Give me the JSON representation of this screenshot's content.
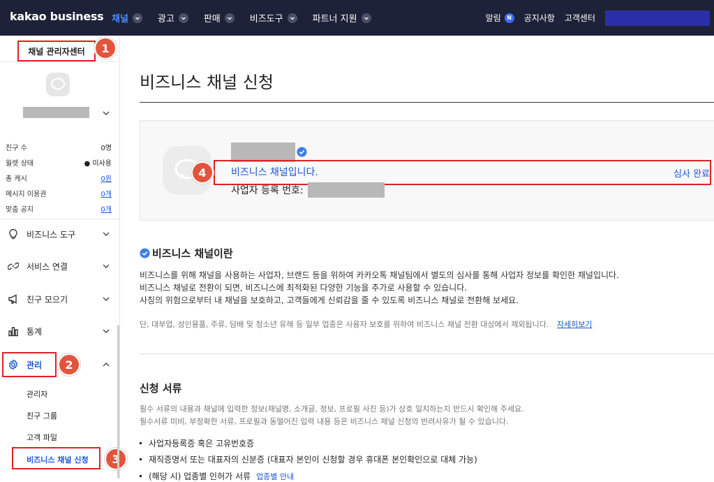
{
  "header": {
    "logo": "kakao business",
    "nav": [
      {
        "label": "채널",
        "active": true
      },
      {
        "label": "광고",
        "active": false
      },
      {
        "label": "판매",
        "active": false
      },
      {
        "label": "비즈도구",
        "active": false
      },
      {
        "label": "파트너 지원",
        "active": false
      }
    ],
    "alerts_label": "알림",
    "alerts_badge": "N",
    "notice_label": "공지사항",
    "support_label": "고객센터"
  },
  "sidebar": {
    "title": "채널 관리자센터",
    "stats": [
      {
        "label": "친구 수",
        "value": "0명"
      },
      {
        "label": "월렛 상태",
        "value": "미사용"
      },
      {
        "label": "총 캐시",
        "value": "0원"
      },
      {
        "label": "메시지 이용권",
        "value": "0개"
      },
      {
        "label": "맞춤 공지",
        "value": "0개"
      }
    ],
    "menu": [
      {
        "label": "비즈니스 도구"
      },
      {
        "label": "서비스 연결"
      },
      {
        "label": "친구 모으기"
      },
      {
        "label": "통계"
      },
      {
        "label": "관리"
      }
    ],
    "submenu": [
      {
        "label": "관리자"
      },
      {
        "label": "친구 그룹"
      },
      {
        "label": "고객 파일"
      },
      {
        "label": "비즈니스 채널 신청"
      }
    ]
  },
  "callouts": [
    "1",
    "2",
    "3",
    "4"
  ],
  "main": {
    "page_title": "비즈니스 채널 신청",
    "card": {
      "channel_type": "비즈니스 채널입니다.",
      "status": "심사 완료",
      "reg_label": "사업자 등록 번호:"
    },
    "about": {
      "title": "비즈니스 채널이란",
      "lines": [
        "비즈니스를 위해 채널을 사용하는 사업자, 브랜드 등을 위하여 카카오톡 채널팀에서 별도의 심사를 통해 사업자 정보를 확인한 채널입니다.",
        "비즈니스 채널로 전환이 되면, 비즈니스에 최적화된 다양한 기능을 추가로 사용할 수 있습니다.",
        "사칭의 위험으로부터 내 채널을 보호하고, 고객들에게 신뢰감을 줄 수 있도록 비즈니스 채널로 전환해 보세요."
      ],
      "note": "단, 대부업, 성인용품, 주류, 담배 및 청소년 유해 등 일부 업종은 사용자 보호를 위하여 비즈니스 채널 전환 대상에서 제외됩니다.",
      "more_link": "자세히보기"
    },
    "docs": {
      "title": "신청 서류",
      "desc": [
        "필수 서류의 내용과 채널에 입력한 정보(채널명, 소개글, 정보, 프로필 사진 등)가 상호 일치하는지 반드시 확인해 주세요.",
        "필수서류 미비, 부정확한 서류, 프로필과 동떨어진 입력 내용 등은 비즈니스 채널 신청의 반려사유가 될 수 있습니다."
      ],
      "items": [
        "사업자등록증 혹은 고유번호증",
        "재직증명서 또는 대표자의 신분증 (대표자 본인이 신청할 경우 휴대폰 본인확인으로 대체 가능)",
        "(해당 시) 업종별 인허가 서류"
      ],
      "guide_link": "업종별 안내"
    }
  }
}
